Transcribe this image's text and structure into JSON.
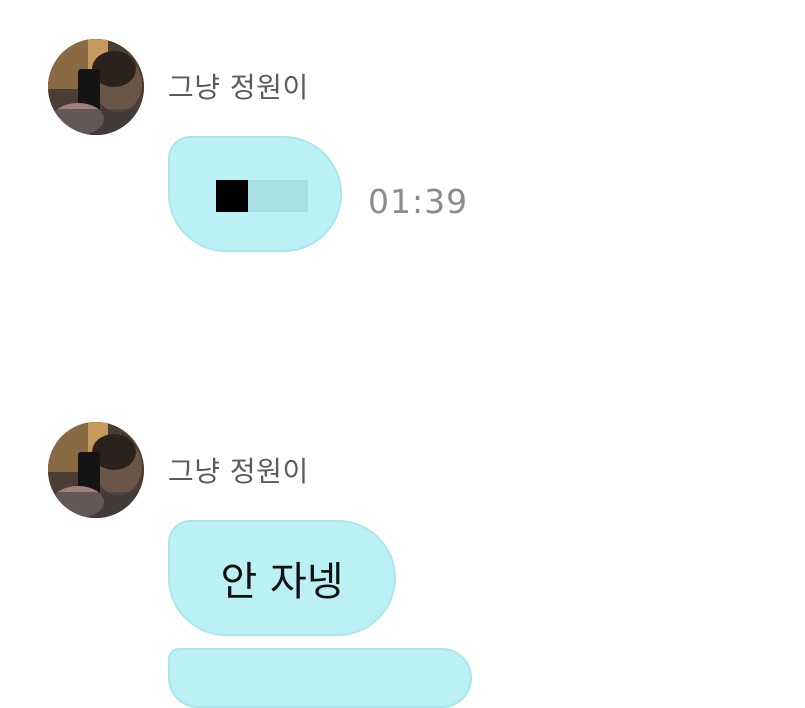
{
  "messages": [
    {
      "sender": "그냥 정원이",
      "bubble_text": "",
      "time": "01:39"
    },
    {
      "sender": "그냥 정원이",
      "bubble_text": "안 자넹"
    }
  ],
  "colors": {
    "bubble_fill": "#bbf1f4",
    "bubble_border": "#a9e7ec",
    "sender_text": "#5b5b5b",
    "timestamp_text": "#8b8b8b"
  }
}
